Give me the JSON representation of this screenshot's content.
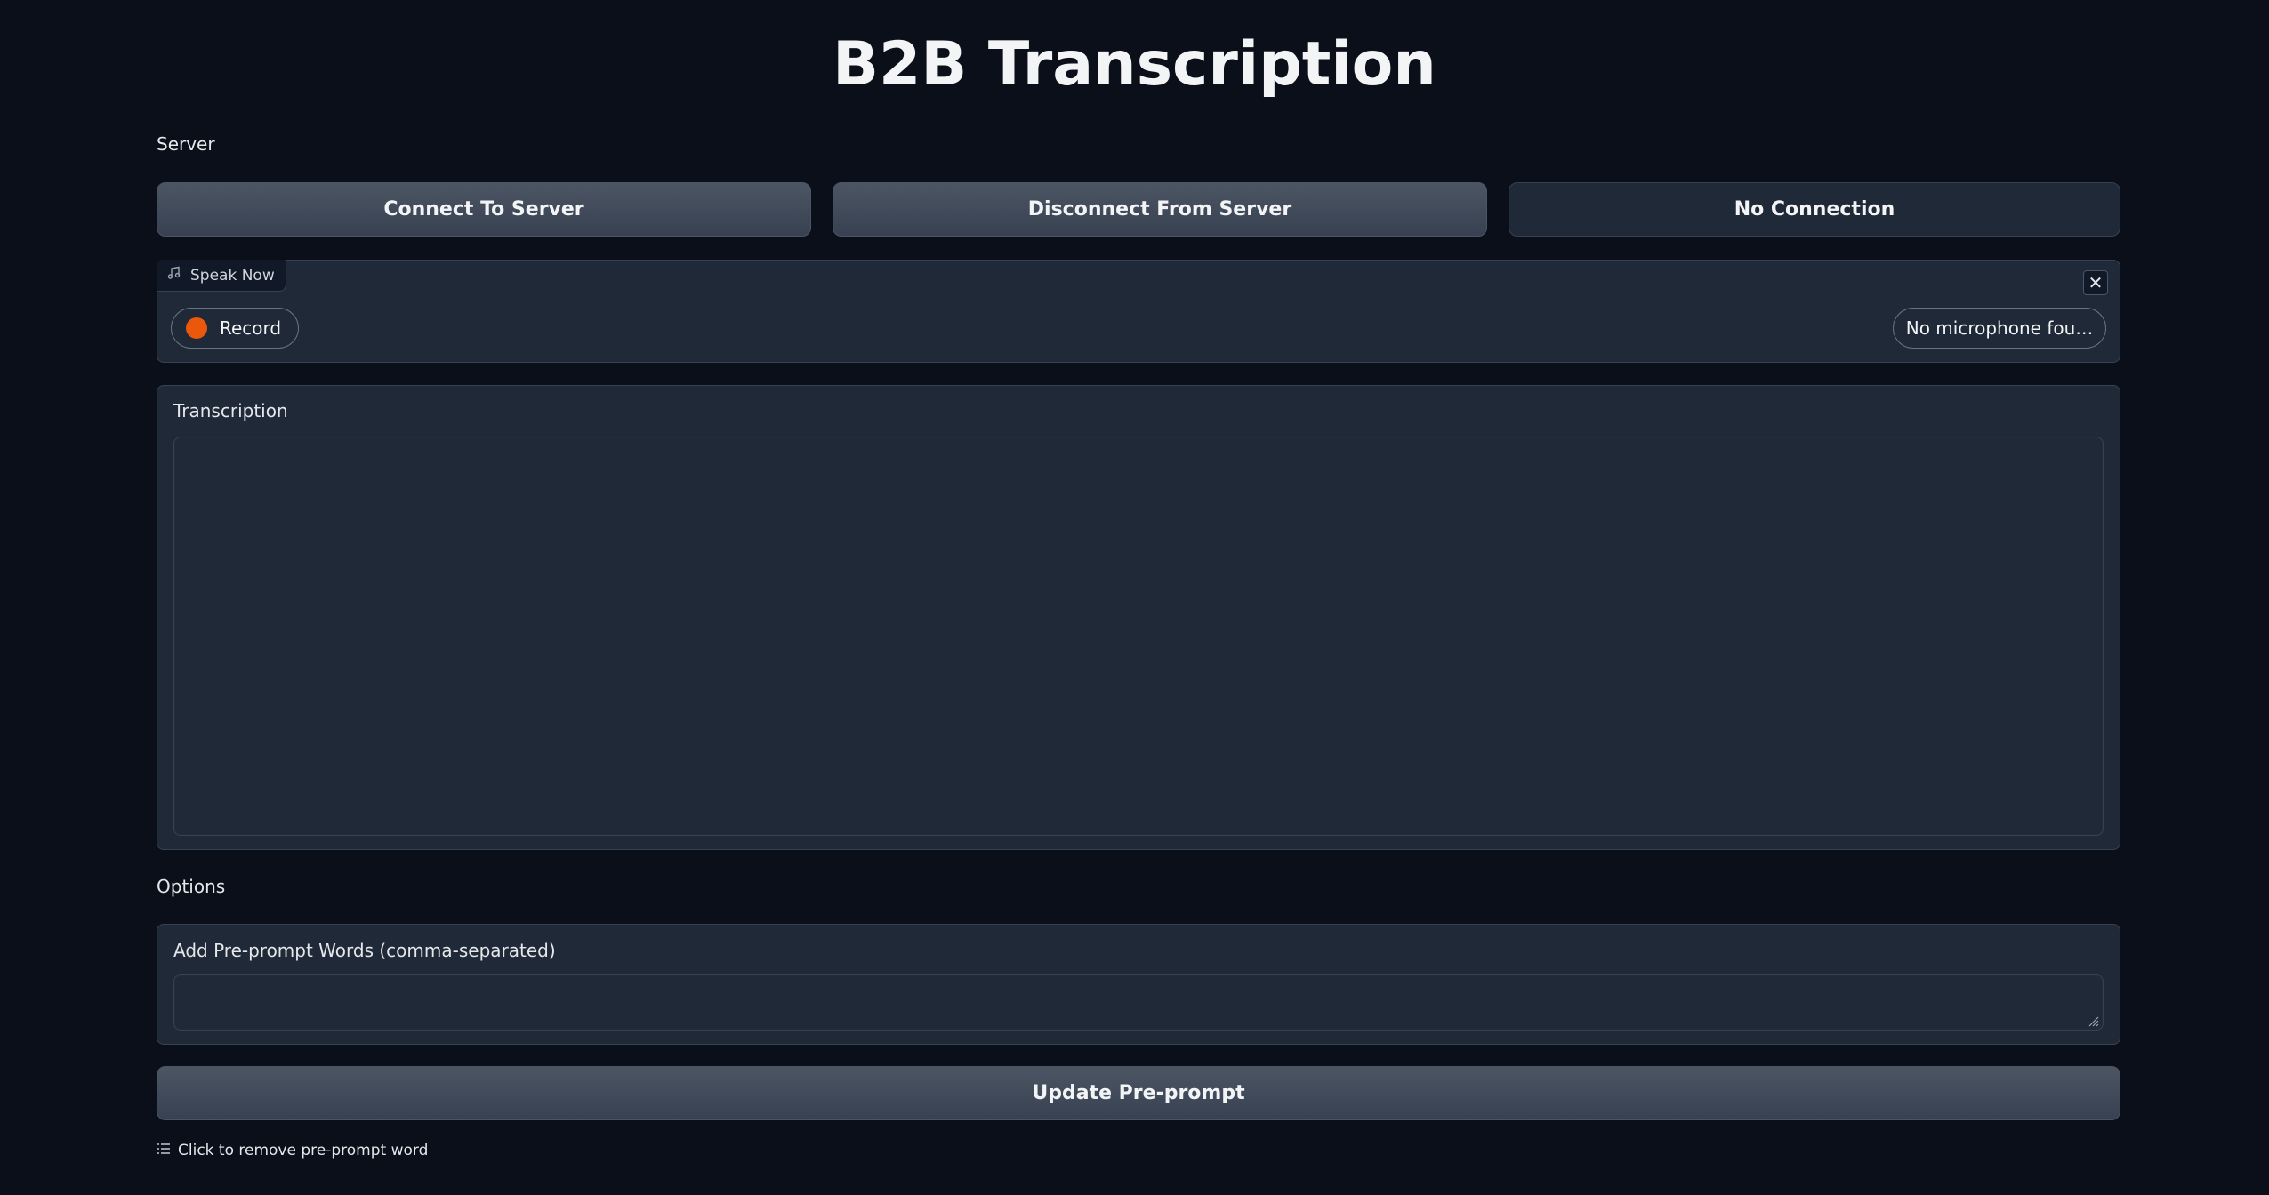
{
  "page": {
    "title": "B2B Transcription"
  },
  "server": {
    "section_label": "Server",
    "connect_label": "Connect To Server",
    "disconnect_label": "Disconnect From Server",
    "status_text": "No Connection"
  },
  "audio": {
    "tag_label": "Speak Now",
    "record_label": "Record",
    "mic_label": "No microphone fou…",
    "close_symbol": "✕"
  },
  "transcription": {
    "label": "Transcription",
    "value": ""
  },
  "options": {
    "section_label": "Options",
    "preprompt_label": "Add Pre-prompt Words (comma-separated)",
    "preprompt_value": "",
    "update_label": "Update Pre-prompt",
    "hint_text": "Click to remove pre-prompt word"
  },
  "colors": {
    "background": "#0b0f19",
    "panel": "#1f2937",
    "button": "#4b5563",
    "record_dot": "#ea580c"
  }
}
